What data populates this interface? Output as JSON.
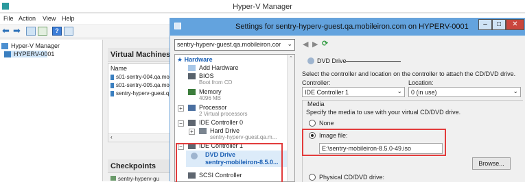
{
  "manager": {
    "title": "Hyper-V Manager",
    "menu": [
      "File",
      "Action",
      "View",
      "Help"
    ],
    "tree": [
      "Hyper-V Manager",
      "HYPERV-0001"
    ],
    "virtual_machines_header": "Virtual Machines",
    "vm_list_header": "Name",
    "vms": [
      "s01-sentry-004.qa.mo",
      "s01-sentry-005.qa.mo",
      "sentry-hyperv-guest.q"
    ],
    "checkpoints_header": "Checkpoints",
    "checkpoint_item": "sentry-hyperv-gu"
  },
  "dialog": {
    "title": "Settings for sentry-hyperv-guest.qa.mobileiron.com on HYPERV-0001",
    "vm_select": "sentry-hyperv-guest.qa.mobileiron.cor",
    "hardware": {
      "header": "Hardware",
      "add_hardware": "Add Hardware",
      "bios": "BIOS",
      "bios_sub": "Boot from CD",
      "memory": "Memory",
      "memory_sub": "4096 MB",
      "processor": "Processor",
      "processor_sub": "2 Virtual processors",
      "ide0": "IDE Controller 0",
      "hard_drive": "Hard Drive",
      "hard_drive_sub": "sentry-hyperv-guest.qa.m...",
      "ide1": "IDE Controller 1",
      "dvd_drive": "DVD Drive",
      "dvd_drive_sub": "sentry-mobileiron-8.5.0...",
      "scsi": "SCSI Controller"
    },
    "detail": {
      "section": "DVD Drive",
      "instructions": "Select the controller and location on the controller to attach the CD/DVD drive.",
      "controller_label": "Controller:",
      "controller_value": "IDE Controller 1",
      "location_label": "Location:",
      "location_value": "0 (in use)",
      "media_label": "Media",
      "media_instructions": "Specify the media to use with your virtual CD/DVD drive.",
      "none_label": "None",
      "image_file_label": "Image file:",
      "image_file_value": "E:\\sentry-mobileiron-8.5.0-49.iso",
      "browse_label": "Browse...",
      "physical_label": "Physical CD/DVD drive:"
    }
  }
}
